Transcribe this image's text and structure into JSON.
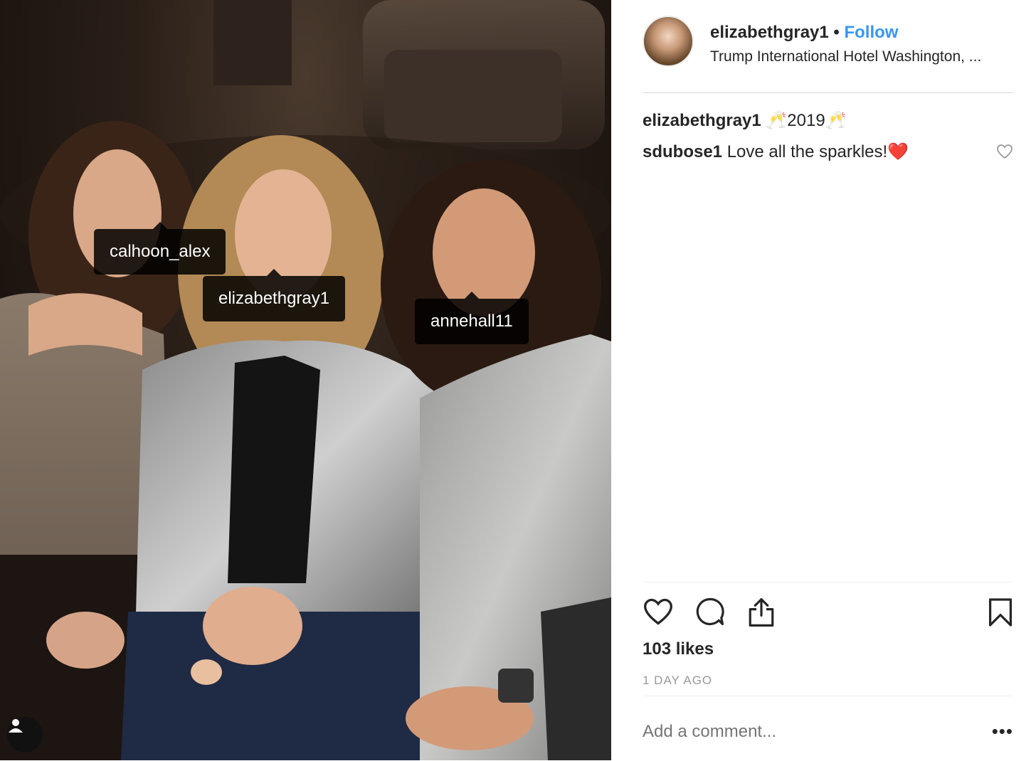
{
  "post": {
    "username": "elizabethgray1",
    "separator": "•",
    "follow_label": "Follow",
    "location": "Trump International Hotel Washington, ..."
  },
  "comments": [
    {
      "user": "elizabethgray1",
      "text": "🥂2019🥂"
    },
    {
      "user": "sdubose1",
      "text": "Love all the sparkles!❤️"
    }
  ],
  "photo_tags": [
    "calhoon_alex",
    "elizabethgray1",
    "annehall11"
  ],
  "likes": "103 likes",
  "timestamp": "1 DAY AGO",
  "add_comment_placeholder": "Add a comment...",
  "more_label": "•••",
  "icons": {
    "like": "heart-icon",
    "comment": "comment-icon",
    "share": "share-icon",
    "save": "bookmark-icon",
    "user_tags": "user-icon",
    "comment_like": "heart-icon"
  },
  "colors": {
    "follow": "#3897f0",
    "text": "#262626",
    "muted": "#999999",
    "divider": "#dbdbdb"
  }
}
